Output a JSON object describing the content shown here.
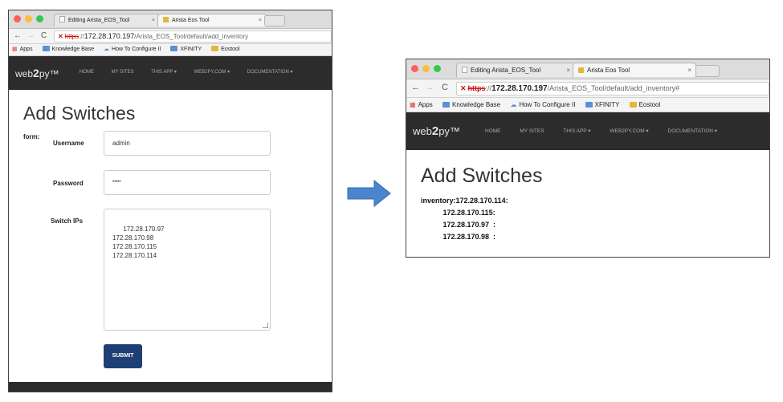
{
  "colors": {
    "navbar": "#2c2c2c",
    "submit": "#1e3f75",
    "arrow": "#4a86d0",
    "dot_red": "#fc605c",
    "dot_yellow": "#fdbc40",
    "dot_green": "#34c84a"
  },
  "left": {
    "tabs": [
      {
        "label": "Editing Arista_EOS_Tool"
      },
      {
        "label": "Arista Eos Tool"
      }
    ],
    "url": {
      "scheme": "https",
      "sep": "://",
      "host": "172.28.170.197",
      "path": "/Arista_EOS_Tool/default/add_inventory"
    },
    "bookmarks": [
      {
        "label": "Apps",
        "icon": "apps-icon"
      },
      {
        "label": "Knowledge Base",
        "icon": "folder-icon"
      },
      {
        "label": "How To Configure II",
        "icon": "cloud-icon"
      },
      {
        "label": "XFINITY",
        "icon": "folder-icon"
      },
      {
        "label": "Eostool",
        "icon": "folder-icon"
      }
    ],
    "navbar": {
      "brand_prefix": "web",
      "brand_num": "2",
      "brand_suffix": "py™",
      "links": [
        "HOME",
        "MY SITES",
        "THIS APP ▾",
        "WEB2PY.COM ▾",
        "DOCUMENTATION ▾"
      ]
    },
    "page_title": "Add Switches",
    "form_label": "form:",
    "username": {
      "label": "Username",
      "value": "admin"
    },
    "password": {
      "label": "Password",
      "value": "•••••"
    },
    "switch_ips": {
      "label": "Switch IPs",
      "value": "172.28.170.97\n172.28.170.98\n172.28.170.115\n172.28.170.114"
    },
    "submit_label": "SUBMIT"
  },
  "right": {
    "tabs": [
      {
        "label": "Editing Arista_EOS_Tool"
      },
      {
        "label": "Arista Eos Tool"
      }
    ],
    "url": {
      "scheme": "https",
      "sep": "://",
      "host": "172.28.170.197",
      "path": "/Arista_EOS_Tool/default/add_inventory#"
    },
    "bookmarks": [
      {
        "label": "Apps",
        "icon": "apps-icon"
      },
      {
        "label": "Knowledge Base",
        "icon": "folder-icon"
      },
      {
        "label": "How To Configure II",
        "icon": "cloud-icon"
      },
      {
        "label": "XFINITY",
        "icon": "folder-icon"
      },
      {
        "label": "Eostool",
        "icon": "folder-icon"
      }
    ],
    "navbar": {
      "brand_prefix": "web",
      "brand_num": "2",
      "brand_suffix": "py™",
      "links": [
        "HOME",
        "MY SITES",
        "THIS APP ▾",
        "WEB2PY.COM ▾",
        "DOCUMENTATION ▾"
      ]
    },
    "page_title": "Add Switches",
    "inventory": [
      "inventory:172.28.170.114:",
      "           172.28.170.115:",
      "           172.28.170.97  :",
      "           172.28.170.98  :"
    ]
  }
}
